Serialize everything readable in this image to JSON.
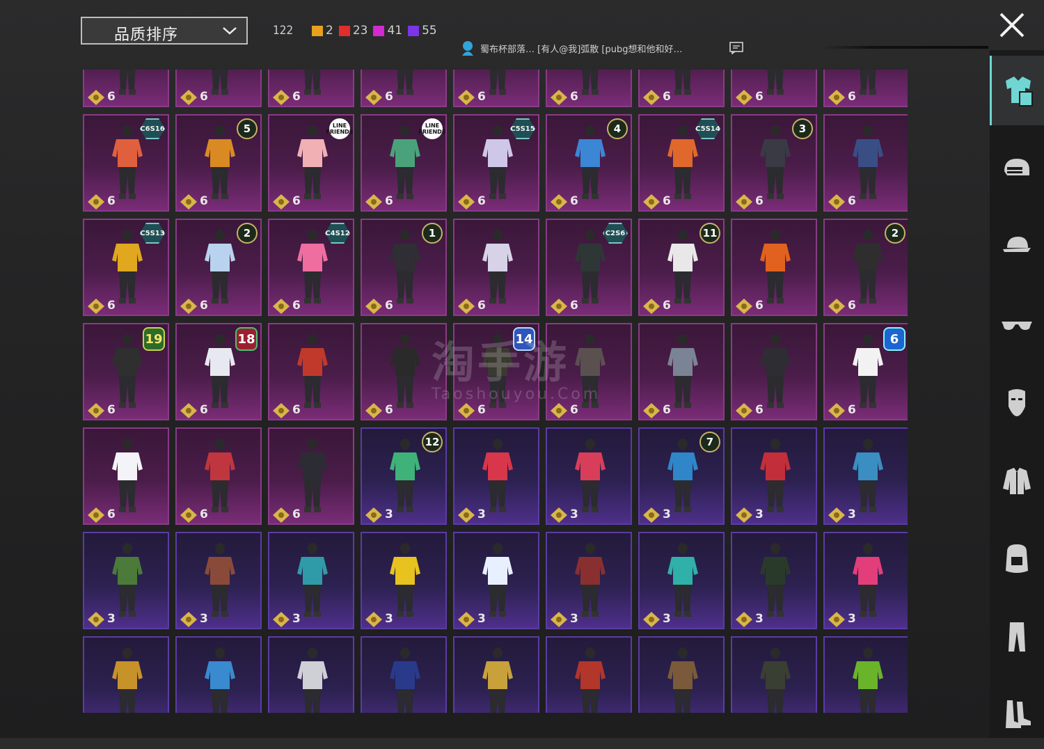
{
  "topbar": {
    "sort_label": "品质排序",
    "total": "122",
    "counts": [
      {
        "value": "2",
        "color": "#e8a11b"
      },
      {
        "value": "23",
        "color": "#e02d2d"
      },
      {
        "value": "41",
        "color": "#d12ad0"
      },
      {
        "value": "55",
        "color": "#7a35e6"
      }
    ],
    "chat_text": "蜀布杯部落… [有人@我]弧散 [pubg想和他和好…"
  },
  "sidebar": {
    "items": [
      {
        "name": "outfit-icon",
        "active": true
      },
      {
        "name": "helmet-icon",
        "active": false
      },
      {
        "name": "cap-icon",
        "active": false
      },
      {
        "name": "glasses-icon",
        "active": false
      },
      {
        "name": "mask-icon",
        "active": false
      },
      {
        "name": "jacket-icon",
        "active": false
      },
      {
        "name": "backpack-icon",
        "active": false
      },
      {
        "name": "pants-icon",
        "active": false
      },
      {
        "name": "shoes-icon",
        "active": false
      }
    ]
  },
  "watermark": {
    "line1": "淘手游",
    "line2": "Taoshouyou.Com"
  },
  "items": [
    {
      "value": "6",
      "tier": "legend",
      "color": "#c74d6e"
    },
    {
      "value": "6",
      "tier": "legend",
      "color": "#7a7a7a"
    },
    {
      "value": "6",
      "tier": "legend",
      "color": "#6a86d4"
    },
    {
      "value": "6",
      "tier": "legend",
      "color": "#a0533a"
    },
    {
      "value": "6",
      "tier": "legend",
      "color": "#777"
    },
    {
      "value": "6",
      "tier": "legend",
      "color": "#b03a3a"
    },
    {
      "value": "6",
      "tier": "legend",
      "color": "#4f9ca4"
    },
    {
      "value": "6",
      "tier": "legend",
      "color": "#bbb"
    },
    {
      "value": "6",
      "tier": "legend",
      "color": "#b0443a"
    },
    {
      "value": "6",
      "tier": "legend",
      "color": "#e0603e",
      "badge": {
        "type": "season",
        "text": "C6S16"
      }
    },
    {
      "value": "6",
      "tier": "legend",
      "color": "#d98a22",
      "badge": {
        "type": "num",
        "text": "5"
      }
    },
    {
      "value": "6",
      "tier": "legend",
      "color": "#f0b0b4",
      "badge": {
        "type": "line",
        "text": "LINE FRIENDS"
      }
    },
    {
      "value": "6",
      "tier": "legend",
      "color": "#4aa27a",
      "badge": {
        "type": "line",
        "text": "LINE FRIENDS"
      }
    },
    {
      "value": "6",
      "tier": "legend",
      "color": "#cfc7e8",
      "badge": {
        "type": "season",
        "text": "C5S15"
      }
    },
    {
      "value": "6",
      "tier": "legend",
      "color": "#3c86d6",
      "badge": {
        "type": "num",
        "text": "4"
      }
    },
    {
      "value": "6",
      "tier": "legend",
      "color": "#e0682a",
      "badge": {
        "type": "season",
        "text": "C5S14"
      }
    },
    {
      "value": "6",
      "tier": "legend",
      "color": "#3a3a44",
      "badge": {
        "type": "num",
        "text": "3"
      }
    },
    {
      "value": "6",
      "tier": "legend",
      "color": "#3a4e86"
    },
    {
      "value": "6",
      "tier": "legend",
      "color": "#e0a81f",
      "badge": {
        "type": "season",
        "text": "C5S13"
      }
    },
    {
      "value": "6",
      "tier": "legend",
      "color": "#b9d3ee",
      "badge": {
        "type": "num",
        "text": "2"
      }
    },
    {
      "value": "6",
      "tier": "legend",
      "color": "#ee6ea0",
      "badge": {
        "type": "season",
        "text": "C4S12"
      }
    },
    {
      "value": "6",
      "tier": "legend",
      "color": "#2e2e34",
      "badge": {
        "type": "num",
        "text": "1"
      }
    },
    {
      "value": "6",
      "tier": "legend",
      "color": "#d8d2e8"
    },
    {
      "value": "6",
      "tier": "legend",
      "color": "#2f3636",
      "badge": {
        "type": "season",
        "text": "C2S6"
      }
    },
    {
      "value": "6",
      "tier": "legend",
      "color": "#e8e8e8",
      "badge": {
        "type": "num",
        "text": "11"
      }
    },
    {
      "value": "6",
      "tier": "legend",
      "color": "#e0621e"
    },
    {
      "value": "6",
      "tier": "legend",
      "color": "#2e2e2e",
      "badge": {
        "type": "num",
        "text": "2"
      }
    },
    {
      "value": "6",
      "tier": "legend",
      "color": "#2f2f2f",
      "badge": {
        "type": "big-green",
        "text": "19"
      }
    },
    {
      "value": "6",
      "tier": "legend",
      "color": "#e8e8f0",
      "badge": {
        "type": "big-red",
        "text": "18"
      }
    },
    {
      "value": "6",
      "tier": "legend",
      "color": "#c0392b"
    },
    {
      "value": "6",
      "tier": "legend",
      "color": "#2a2a2a"
    },
    {
      "value": "6",
      "tier": "legend",
      "color": "#3a3a30",
      "badge": {
        "type": "big-blue",
        "text": "14"
      }
    },
    {
      "value": "6",
      "tier": "legend",
      "color": "#5a5050"
    },
    {
      "value": "6",
      "tier": "legend",
      "color": "#7a8494"
    },
    {
      "value": "6",
      "tier": "legend",
      "color": "#2d2d33"
    },
    {
      "value": "6",
      "tier": "legend",
      "color": "#f2f2f2",
      "badge": {
        "type": "big-cyan",
        "text": "6"
      }
    },
    {
      "value": "6",
      "tier": "legend",
      "color": "#f4f4f8"
    },
    {
      "value": "6",
      "tier": "legend",
      "color": "#c0363e"
    },
    {
      "value": "6",
      "tier": "legend",
      "color": "#2c2c34"
    },
    {
      "value": "3",
      "tier": "epic",
      "color": "#3fb27a",
      "badge": {
        "type": "num",
        "text": "12"
      }
    },
    {
      "value": "3",
      "tier": "epic",
      "color": "#d8364a"
    },
    {
      "value": "3",
      "tier": "epic",
      "color": "#d83e5a"
    },
    {
      "value": "3",
      "tier": "epic",
      "color": "#2f86c8",
      "badge": {
        "type": "num",
        "text": "7"
      }
    },
    {
      "value": "3",
      "tier": "epic",
      "color": "#c22f3a"
    },
    {
      "value": "3",
      "tier": "epic",
      "color": "#3a8ec2"
    },
    {
      "value": "3",
      "tier": "epic",
      "color": "#4b7a3a"
    },
    {
      "value": "3",
      "tier": "epic",
      "color": "#8a4a3a"
    },
    {
      "value": "3",
      "tier": "epic",
      "color": "#2f9aa8"
    },
    {
      "value": "3",
      "tier": "epic",
      "color": "#e8c21e"
    },
    {
      "value": "3",
      "tier": "epic",
      "color": "#e8f0ff"
    },
    {
      "value": "3",
      "tier": "epic",
      "color": "#8a2f2f"
    },
    {
      "value": "3",
      "tier": "epic",
      "color": "#2fb0a8"
    },
    {
      "value": "3",
      "tier": "epic",
      "color": "#2a3a2a"
    },
    {
      "value": "3",
      "tier": "epic",
      "color": "#e23e7a"
    },
    {
      "value": "3",
      "tier": "epic",
      "color": "#c8922a"
    },
    {
      "value": "3",
      "tier": "epic",
      "color": "#3a8ad0"
    },
    {
      "value": "3",
      "tier": "epic",
      "color": "#cfcfd6"
    },
    {
      "value": "3",
      "tier": "epic",
      "color": "#2a3a8a"
    },
    {
      "value": "3",
      "tier": "epic",
      "color": "#c8a13a"
    },
    {
      "value": "3",
      "tier": "epic",
      "color": "#b2362a"
    },
    {
      "value": "3",
      "tier": "epic",
      "color": "#7a5a3a"
    },
    {
      "value": "3",
      "tier": "epic",
      "color": "#3a3f34"
    },
    {
      "value": "3",
      "tier": "epic",
      "color": "#6ab42a"
    }
  ]
}
